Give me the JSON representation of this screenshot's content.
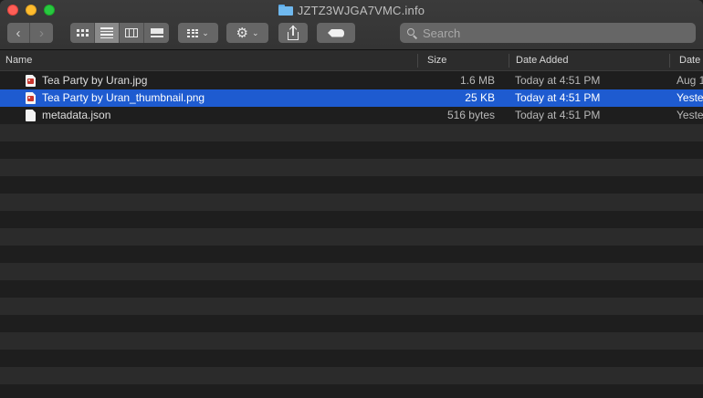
{
  "window": {
    "title": "JZTZ3WJGA7VMC.info",
    "title_icon": "folder-icon"
  },
  "toolbar": {
    "back_icon": "chevron-left-icon",
    "forward_icon": "chevron-right-icon",
    "view_modes": [
      {
        "name": "icon-view",
        "icon": "grid-icon",
        "active": false
      },
      {
        "name": "list-view",
        "icon": "list-icon",
        "active": true
      },
      {
        "name": "column-view",
        "icon": "columns-icon",
        "active": false
      },
      {
        "name": "gallery-view",
        "icon": "gallery-icon",
        "active": false
      }
    ],
    "group_icon": "group-grid-icon",
    "action_icon": "gear-icon",
    "share_icon": "share-icon",
    "tag_icon": "tag-icon"
  },
  "search": {
    "placeholder": "Search",
    "value": ""
  },
  "columns": {
    "name": "Name",
    "size": "Size",
    "date_added": "Date Added",
    "date": "Date"
  },
  "files": [
    {
      "name": "Tea Party by Uran.jpg",
      "size": "1.6 MB",
      "date_added": "Today at 4:51 PM",
      "date": "Aug 1",
      "type": "image",
      "selected": false
    },
    {
      "name": "Tea Party by Uran_thumbnail.png",
      "size": "25 KB",
      "date_added": "Today at 4:51 PM",
      "date": "Yeste",
      "type": "image",
      "selected": true
    },
    {
      "name": "metadata.json",
      "size": "516 bytes",
      "date_added": "Today at 4:51 PM",
      "date": "Yeste",
      "type": "document",
      "selected": false
    }
  ],
  "colors": {
    "selection": "#1e5bd0",
    "row_alt": "#2b2b2b",
    "background": "#1e1e1e"
  }
}
